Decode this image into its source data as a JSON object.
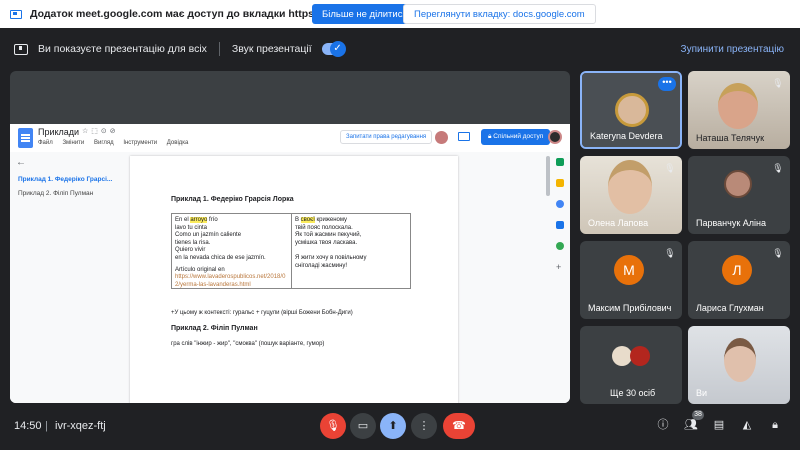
{
  "share_banner": {
    "message": "Додаток meet.google.com має доступ до вкладки https://docs.google.com",
    "stop_sharing_label": "Більше не ділитися",
    "view_tab_label": "Переглянути вкладку: docs.google.com"
  },
  "presentation_bar": {
    "status_text": "Ви показуєте презентацію для всіх",
    "audio_label": "Звук презентації",
    "audio_enabled": true,
    "stop_label": "Зупинити презентацію"
  },
  "doc": {
    "title": "Приклади",
    "menu": [
      "Файл",
      "Змінити",
      "Вигляд",
      "Інструменти",
      "Довідка"
    ],
    "request_edit_label": "Запитати права редагування",
    "share_label": "Спільний доступ",
    "outline": [
      {
        "label": "Приклад 1. Федеріко Грарсі...",
        "active": true
      },
      {
        "label": "Приклад 2. Філіп Пулман",
        "active": false
      }
    ],
    "heading1": "Приклад 1. Федеріко Грарсія Лорка",
    "table": {
      "left_lines": [
        "En el ",
        "arroyo",
        " frío",
        "lavo tu cinta",
        "Como un jazmín caliente",
        "tienes la risa.",
        "Quiero vivir",
        "en la nevada chica de ese jazmín."
      ],
      "left_source_label": "Artículo original en",
      "left_source_link": "https://www.lavaderospublicos.net/2018/02/yerma-las-lavanderas.html",
      "right_lines": [
        "В ",
        "своєї",
        " криженому",
        "твій пояс полоскала.",
        "Як той жасмин пекучий,",
        "усмішка твоя ласкава.",
        "",
        "Я жити хочу в повільному",
        "сніголаді жасмину!"
      ]
    },
    "paragraph1": "+У цьому ж контексті: гуральс + гуцули (вірші Божени Бобн-Диги)",
    "heading2": "Приклад 2. Філіп Пулман",
    "paragraph2": "гра слів \"інжир - жир\", \"смоква\" (пошук варіанте, гумор)"
  },
  "participants": [
    {
      "name": "Kateryna Devdera",
      "active": true,
      "muted": false
    },
    {
      "name": "Наташа Телячук",
      "active": false,
      "muted": true
    },
    {
      "name": "Олена Лапова",
      "active": false,
      "muted": true
    },
    {
      "name": "Парванчук Аліна",
      "active": false,
      "muted": true
    },
    {
      "name": "Максим Прибілович",
      "active": false,
      "muted": true,
      "initial": "М",
      "color": "#e8710a"
    },
    {
      "name": "Лариса Глухман",
      "active": false,
      "muted": true,
      "initial": "Л",
      "color": "#e8710a"
    },
    {
      "name": "Ще 30 осіб",
      "active": false,
      "muted": false
    },
    {
      "name": "Ви",
      "active": false,
      "muted": false
    }
  ],
  "bottom_bar": {
    "time": "14:50",
    "separator": "|",
    "meeting_code": "ivr-xqez-ftj",
    "people_count": "38",
    "controls": [
      "mic-off-icon",
      "camera-icon",
      "present-icon",
      "more-vert-icon",
      "call-end-icon"
    ],
    "right_controls": [
      "info-icon",
      "people-icon",
      "chat-icon",
      "activities-icon",
      "host-controls-icon"
    ]
  },
  "colors": {
    "meet_bg": "#202124",
    "tile_bg": "#3c4043",
    "accent_blue": "#1a73e8",
    "accent_light_blue": "#8ab4f8",
    "end_call_red": "#ea4335"
  }
}
